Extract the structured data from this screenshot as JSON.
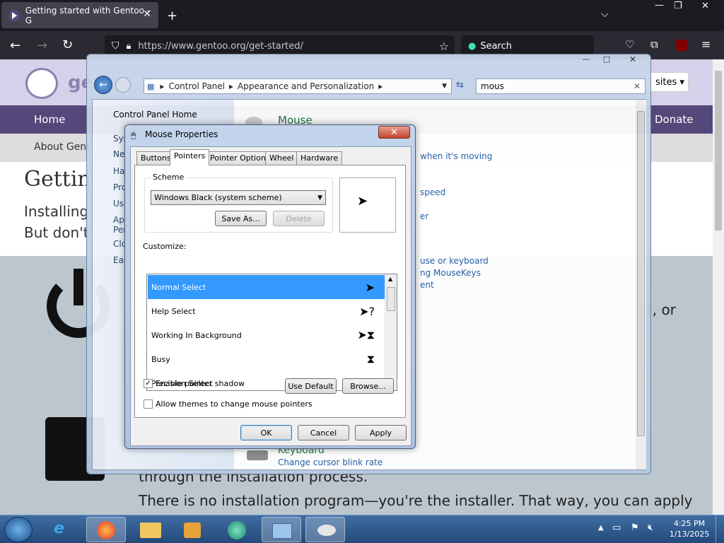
{
  "browser": {
    "tab_title": "Getting started with Gentoo – G",
    "url": "https://www.gentoo.org/get-started/",
    "search_placeholder": "Search"
  },
  "gentoo": {
    "logo_text": "gen",
    "sites_label": "sites ▾",
    "nav_home": "Home",
    "nav_donate": "Donate",
    "sub_about": "About Gent",
    "heading": "Gettin",
    "intro_line1": "Installing",
    "intro_line2": "But don't",
    "right_text": "3, or",
    "bottom_line1": "through the installation process.",
    "bottom_line2": "There is no installation program—you're the installer. That way, you can apply"
  },
  "control_panel": {
    "breadcrumb": [
      "Control Panel",
      "Appearance and Personalization"
    ],
    "search_value": "mous",
    "left_home": "Control Panel Home",
    "left_items": [
      "Sys",
      "Ne",
      "Ha",
      "Pro",
      "Use",
      "Ap",
      "Per",
      "Clo",
      "Eas"
    ],
    "mouse_heading": "Mouse",
    "links": [
      "when it's moving",
      "speed",
      "er",
      "use or keyboard",
      "ng MouseKeys",
      "ent"
    ],
    "keyboard_heading": "Keyboard",
    "keyboard_link": "Change cursor blink rate"
  },
  "dialog": {
    "title": "Mouse Properties",
    "tabs": [
      "Buttons",
      "Pointers",
      "Pointer Options",
      "Wheel",
      "Hardware"
    ],
    "active_tab": "Pointers",
    "scheme_label": "Scheme",
    "scheme_value": "Windows Black (system scheme)",
    "save_as": "Save As...",
    "delete": "Delete",
    "customize_label": "Customize:",
    "cursors": [
      {
        "name": "Normal Select",
        "icon": "arrow"
      },
      {
        "name": "Help Select",
        "icon": "arrow-question"
      },
      {
        "name": "Working In Background",
        "icon": "arrow-hourglass"
      },
      {
        "name": "Busy",
        "icon": "hourglass"
      },
      {
        "name": "Precision Select",
        "icon": "crosshair"
      }
    ],
    "enable_shadow": "Enable pointer shadow",
    "enable_shadow_checked": true,
    "allow_themes": "Allow themes to change mouse pointers",
    "allow_themes_checked": false,
    "use_default": "Use Default",
    "browse": "Browse...",
    "ok": "OK",
    "cancel": "Cancel",
    "apply": "Apply"
  },
  "taskbar": {
    "time": "4:25 PM",
    "date": "1/13/2025"
  }
}
